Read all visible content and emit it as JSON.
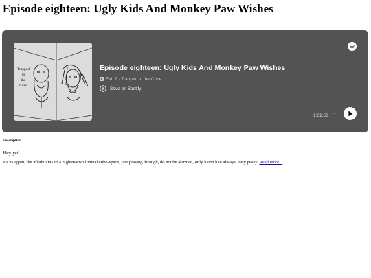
{
  "page": {
    "title": "Episode eighteen: Ugly Kids And Monkey Paw Wishes"
  },
  "player": {
    "background_color": "#535353",
    "cover": {
      "icon": "podcast-cover-art",
      "text_lines": [
        "Trapped",
        "in",
        "the",
        "Cube"
      ]
    },
    "episode_title": "Episode eighteen: Ugly Kids And Monkey Paw Wishes",
    "explicit_badge": "E",
    "meta": "Feb 7 · Trapped in the Cube",
    "save_label": "Save on Spotify",
    "duration": "1:01:50",
    "more_label": "···",
    "icons": {
      "brand": "spotify-icon",
      "save": "plus-circle-icon",
      "more": "more-options-icon",
      "play": "play-icon"
    }
  },
  "description": {
    "heading": "Description",
    "greeting": "Hey yo!",
    "body": "It's us again, the inhabitants of a nightmarish liminal cube-space, just passing through, do not be alarmed, only listen like always, easy peasy. ",
    "read_more": "Read more..."
  }
}
